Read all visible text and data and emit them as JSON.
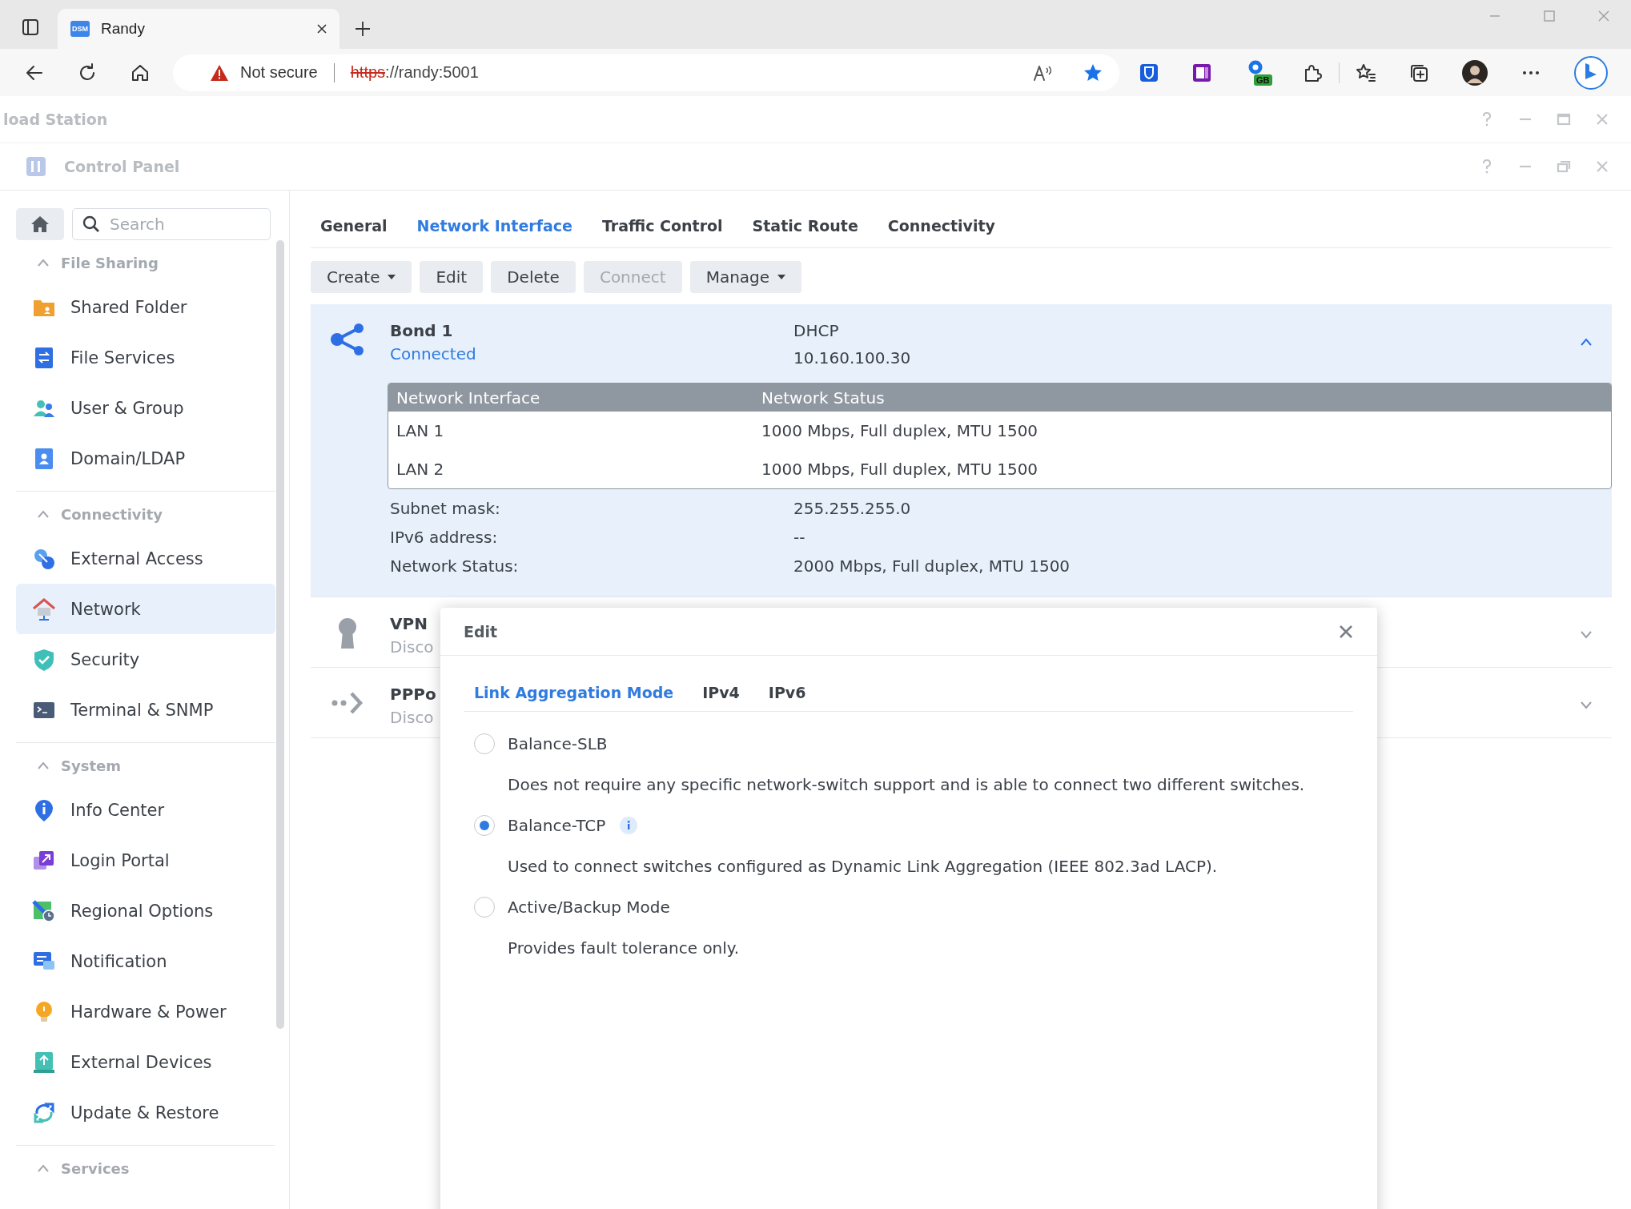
{
  "browser": {
    "favicon_text": "DSM",
    "tab_title": "Randy",
    "security_label": "Not secure",
    "url_scheme": "https",
    "url_rest": "://randy:5001",
    "extension_badge": "GB"
  },
  "background_window": {
    "title": "load Station"
  },
  "window": {
    "title": "Control Panel"
  },
  "sidebar": {
    "search": {
      "placeholder": "Search"
    },
    "sections": [
      {
        "title": "File Sharing",
        "expanded": true,
        "items": [
          {
            "label": "Shared Folder",
            "selected": false
          },
          {
            "label": "File Services",
            "selected": false
          },
          {
            "label": "User & Group",
            "selected": false
          },
          {
            "label": "Domain/LDAP",
            "selected": false
          }
        ]
      },
      {
        "title": "Connectivity",
        "expanded": true,
        "items": [
          {
            "label": "External Access",
            "selected": false
          },
          {
            "label": "Network",
            "selected": true
          },
          {
            "label": "Security",
            "selected": false
          },
          {
            "label": "Terminal & SNMP",
            "selected": false
          }
        ]
      },
      {
        "title": "System",
        "expanded": true,
        "items": [
          {
            "label": "Info Center",
            "selected": false
          },
          {
            "label": "Login Portal",
            "selected": false
          },
          {
            "label": "Regional Options",
            "selected": false
          },
          {
            "label": "Notification",
            "selected": false
          },
          {
            "label": "Hardware & Power",
            "selected": false
          },
          {
            "label": "External Devices",
            "selected": false
          },
          {
            "label": "Update & Restore",
            "selected": false
          }
        ]
      },
      {
        "title": "Services",
        "expanded": true
      }
    ]
  },
  "tabs": [
    {
      "label": "General",
      "selected": false
    },
    {
      "label": "Network Interface",
      "selected": true
    },
    {
      "label": "Traffic Control",
      "selected": false
    },
    {
      "label": "Static Route",
      "selected": false
    },
    {
      "label": "Connectivity",
      "selected": false
    }
  ],
  "toolbar": [
    {
      "label": "Create",
      "disabled": false,
      "dropdown": true
    },
    {
      "label": "Edit",
      "disabled": false,
      "dropdown": false
    },
    {
      "label": "Delete",
      "disabled": false,
      "dropdown": false
    },
    {
      "label": "Connect",
      "disabled": true,
      "dropdown": false
    },
    {
      "label": "Manage",
      "disabled": false,
      "dropdown": true
    }
  ],
  "interfaces": [
    {
      "kind": "bond",
      "name": "Bond 1",
      "status": "Connected",
      "connected": true,
      "expanded": true,
      "mode": "DHCP",
      "address": "10.160.100.30",
      "members": {
        "columns": [
          "Network Interface",
          "Network Status"
        ],
        "rows": [
          [
            "LAN 1",
            "1000 Mbps, Full duplex, MTU 1500"
          ],
          [
            "LAN 2",
            "1000 Mbps, Full duplex, MTU 1500"
          ]
        ]
      },
      "details": [
        {
          "label": "Subnet mask:",
          "value": "255.255.255.0"
        },
        {
          "label": "IPv6 address:",
          "value": "--"
        },
        {
          "label": "Network Status:",
          "value": "2000 Mbps, Full duplex, MTU 1500"
        }
      ]
    },
    {
      "kind": "vpn",
      "name": "VPN",
      "status": "Disco",
      "connected": false,
      "expanded": false
    },
    {
      "kind": "pppoe",
      "name": "PPPo",
      "status": "Disco",
      "connected": false,
      "expanded": false
    }
  ],
  "dialog": {
    "title": "Edit",
    "tabs": [
      {
        "label": "Link Aggregation Mode",
        "selected": true
      },
      {
        "label": "IPv4",
        "selected": false
      },
      {
        "label": "IPv6",
        "selected": false
      }
    ],
    "options": [
      {
        "label": "Balance-SLB",
        "selected": false,
        "info": false,
        "description": "Does not require any specific network-switch support and is able to connect two different switches."
      },
      {
        "label": "Balance-TCP",
        "selected": true,
        "info": true,
        "description": "Used to connect switches configured as Dynamic Link Aggregation (IEEE 802.3ad LACP)."
      },
      {
        "label": "Active/Backup Mode",
        "selected": false,
        "info": false,
        "description": "Provides fault tolerance only."
      }
    ]
  }
}
